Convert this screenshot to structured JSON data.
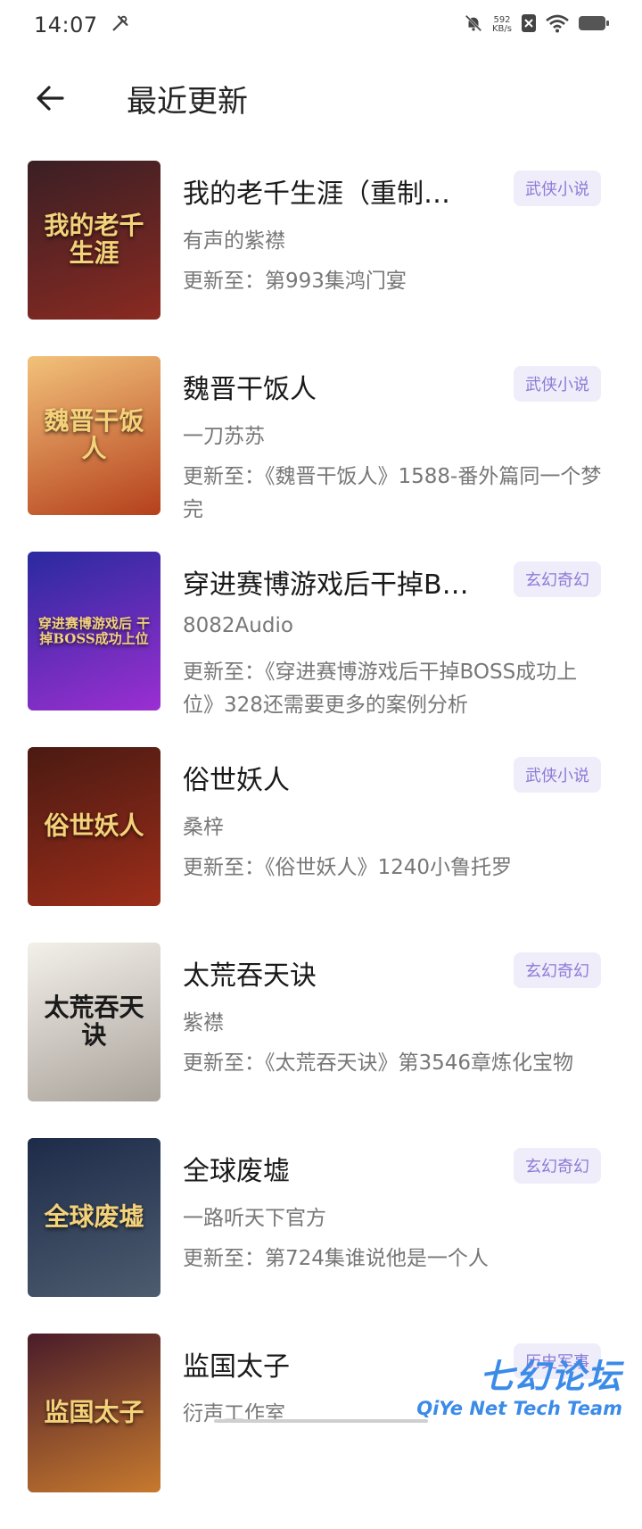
{
  "status_bar": {
    "time": "14:07",
    "net_speed_value": "592",
    "net_speed_unit": "KB/s"
  },
  "header": {
    "title": "最近更新"
  },
  "books": [
    {
      "title": "我的老千生涯（重制…",
      "author": "有声的紫襟",
      "update": "更新至：第993集鸿门宴",
      "tag": "武侠小说",
      "cover_text": "我的老千生涯",
      "cover_colors": [
        "#3a1f24",
        "#8a2a22"
      ]
    },
    {
      "title": "魏晋干饭人",
      "author": "一刀苏苏",
      "update": "更新至：《魏晋干饭人》1588-番外篇同一个梦完",
      "tag": "武侠小说",
      "cover_text": "魏晋干饭人",
      "cover_colors": [
        "#f2c27a",
        "#b5401c"
      ]
    },
    {
      "title": "穿进赛博游戏后干掉B…",
      "author": "8082Audio",
      "update": "更新至：《穿进赛博游戏后干掉BOSS成功上位》328还需要更多的案例分析",
      "tag": "玄幻奇幻",
      "cover_text": "穿进赛博游戏后 干掉BOSS成功上位",
      "cover_colors": [
        "#2a2a9e",
        "#9b2fd1"
      ]
    },
    {
      "title": "俗世妖人",
      "author": "桑梓",
      "update": "更新至：《俗世妖人》1240小鲁托罗",
      "tag": "武侠小说",
      "cover_text": "俗世妖人",
      "cover_colors": [
        "#4a1a12",
        "#9c2d1a"
      ]
    },
    {
      "title": "太荒吞天诀",
      "author": "紫襟",
      "update": "更新至：《太荒吞天诀》第3546章炼化宝物",
      "tag": "玄幻奇幻",
      "cover_text": "太荒吞天诀",
      "cover_colors": [
        "#f3f0ea",
        "#a9a29a"
      ]
    },
    {
      "title": "全球废墟",
      "author": "一路听天下官方",
      "update": "更新至：第724集谁说他是一个人",
      "tag": "玄幻奇幻",
      "cover_text": "全球废墟",
      "cover_colors": [
        "#1d2b4a",
        "#4d5c6e"
      ]
    },
    {
      "title": "监国太子",
      "author": "衍声工作室",
      "update": "",
      "tag": "历史军事",
      "cover_text": "监国太子",
      "cover_colors": [
        "#4a1c2a",
        "#c77a2e"
      ]
    }
  ],
  "watermark": {
    "cn": "七幻论坛",
    "en": "QiYe Net Tech Team"
  }
}
